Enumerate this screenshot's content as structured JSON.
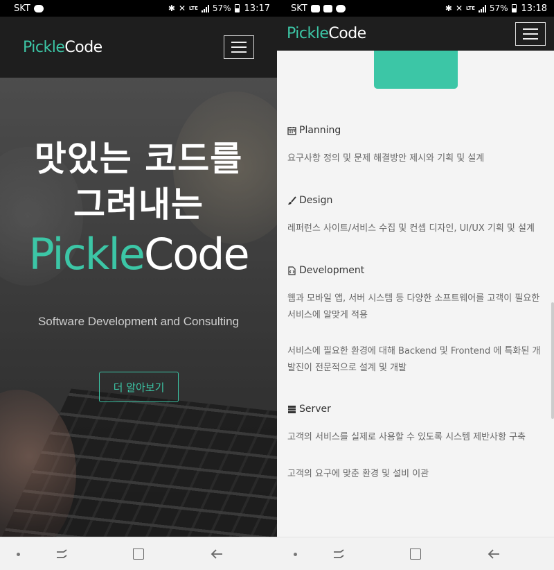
{
  "left": {
    "status": {
      "carrier": "SKT",
      "battery": "57%",
      "network": "LTE",
      "time": "13:17"
    },
    "header": {
      "logo_part1": "Pickle",
      "logo_part2": "Code"
    },
    "hero": {
      "title_line1": "맛있는 코드를",
      "title_line2": "그려내는",
      "brand_part1": "Pickle",
      "brand_part2": "Code",
      "subtitle": "Software Development and Consulting",
      "cta_label": "더 알아보기"
    }
  },
  "right": {
    "status": {
      "carrier": "SKT",
      "battery": "57%",
      "network": "LTE",
      "time": "13:18"
    },
    "header": {
      "logo_part1": "Pickle",
      "logo_part2": "Code"
    },
    "sections": [
      {
        "icon": "calendar-icon",
        "title": "Planning",
        "paragraphs": [
          "요구사항 정의 및 문제 해결방안 제시와 기획 및 설계"
        ]
      },
      {
        "icon": "paintbrush-icon",
        "title": "Design",
        "paragraphs": [
          "레퍼런스 사이트/서비스 수집 및 컨셉 디자인, UI/UX 기획 및 설계"
        ]
      },
      {
        "icon": "code-file-icon",
        "title": "Development",
        "paragraphs": [
          "웹과 모바일 앱, 서버 시스템 등 다양한 소프트웨어를 고객이 필요한 서비스에 알맞게 적용",
          "서비스에 필요한 환경에 대해 Backend 및 Frontend 에 특화된 개발진이 전문적으로 설계 및 개발"
        ]
      },
      {
        "icon": "server-icon",
        "title": "Server",
        "paragraphs": [
          "고객의 서비스를 실제로 사용할 수 있도록 시스템 제반사항 구축",
          "고객의 요구에 맞춘 환경 및 설비 이관"
        ]
      }
    ]
  },
  "colors": {
    "accent": "#3cc6a6",
    "header_bg": "#1e1e1e",
    "content_bg": "#f4f4f4"
  }
}
